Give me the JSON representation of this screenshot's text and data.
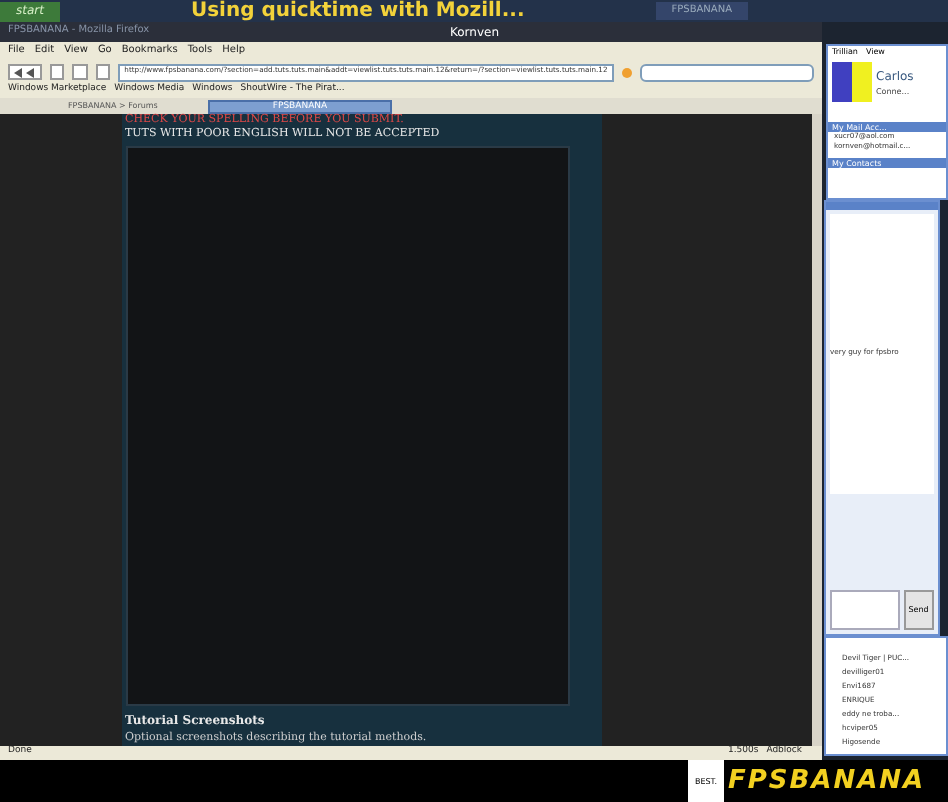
{
  "taskbar": {
    "start": "start",
    "caption": "Using quicktime with Mozill...",
    "task": "FPSBANANA"
  },
  "browser": {
    "title": "FPSBANANA - Mozilla Firefox",
    "caption": "Kornven",
    "menu": [
      "File",
      "Edit",
      "View",
      "Go",
      "Bookmarks",
      "Tools",
      "Help"
    ],
    "url": "http://www.fpsbanana.com/?section=add.tuts.tuts.main&addt=viewlist.tuts.tuts.main.12&return=/?section=viewlist.tuts.tuts.main.12",
    "bookmarks": [
      "Windows Marketplace",
      "Windows Media",
      "Windows",
      "ShoutWire - The Pirat..."
    ],
    "breadcrumb": "FPSBANANA > Forums",
    "tabs": [
      {
        "label": "FPSBANANA",
        "selected": true
      }
    ],
    "status": {
      "text": "Done",
      "time": "1.500s",
      "addon": "Adblock"
    }
  },
  "content": {
    "warning": "CHECK YOUR SPELLING BEFORE YOU SUBMIT.",
    "notice": "TUTS WITH POOR ENGLISH WILL NOT BE ACCEPTED",
    "section_title": "Tutorial Screenshots",
    "section_desc": "Optional screenshots describing the tutorial methods."
  },
  "trillian": {
    "menu": [
      "Trillian",
      "View"
    ],
    "name": "Carlos",
    "status": "Conne...",
    "mail_header": "My Mail Acc...",
    "mail": [
      "xucr07@aol.com",
      "kornven@hotmail.c..."
    ],
    "contacts_header": "My Contacts"
  },
  "chat": {
    "message": "very guy for fpsbro",
    "button": "Send"
  },
  "contacts": [
    "Devil Tiger | PUC...",
    "devilliger01",
    "Envi1687",
    "ENRIQUE",
    "eddy ne troba...",
    "hcviper05",
    "Higosende"
  ],
  "footer": {
    "badge": "BEST.",
    "logo": "FPSBANANA"
  }
}
